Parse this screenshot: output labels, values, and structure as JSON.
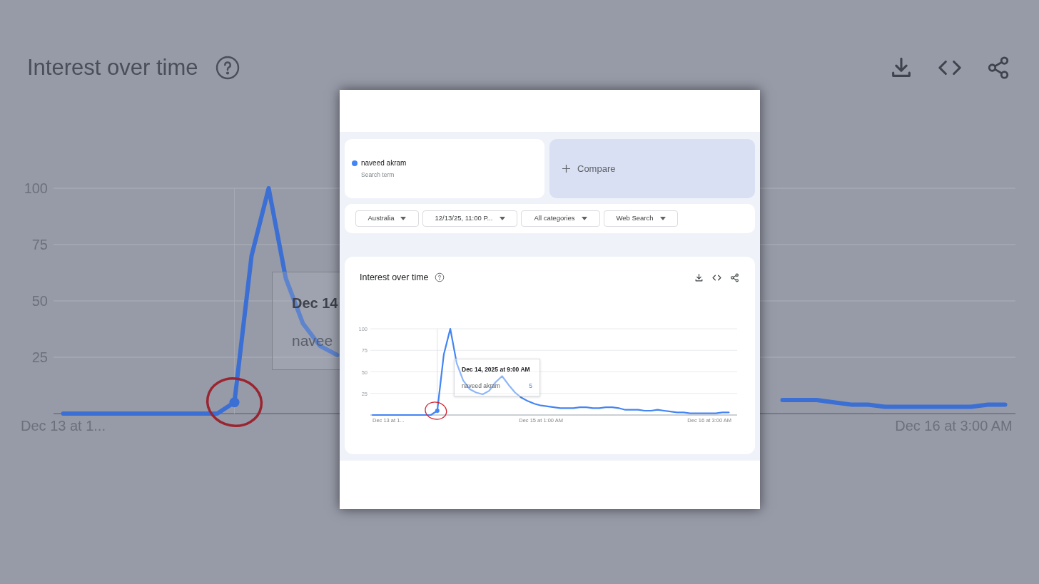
{
  "background": {
    "title": "Interest over time",
    "chart_data": {
      "type": "line",
      "ylim": [
        0,
        100
      ],
      "yticks": [
        25,
        50,
        75,
        100
      ],
      "grid": true,
      "series": [
        {
          "color": "#3b6fd4",
          "values": [
            0,
            0,
            0,
            0,
            0,
            0,
            0,
            0,
            0,
            0,
            5,
            70,
            100,
            60,
            40,
            30,
            26,
            null,
            null,
            null,
            null,
            null,
            null,
            null,
            null,
            null,
            null,
            null,
            null,
            null,
            null,
            null,
            null,
            null,
            null,
            null,
            null,
            null,
            null,
            null,
            null,
            null,
            6,
            6,
            6,
            5,
            4,
            4,
            3,
            3,
            3,
            3,
            3,
            3,
            4,
            4
          ]
        }
      ]
    },
    "x_labels": [
      "Dec 13 at 1...",
      "Dec 16 at 3:00 AM"
    ],
    "tooltip": {
      "title": "Dec 14",
      "term": "navee"
    }
  },
  "frame": {
    "search_term": {
      "name": "naveed akram",
      "subtitle": "Search term",
      "color": "#4285f4"
    },
    "compare": "Compare",
    "filters": [
      "Australia",
      "12/13/25, 11:00 P...",
      "All categories",
      "Web Search"
    ],
    "card": {
      "title": "Interest over time",
      "chart_data": {
        "type": "line",
        "ylim": [
          0,
          100
        ],
        "yticks": [
          25,
          50,
          75,
          100
        ],
        "grid": true,
        "series": [
          {
            "color": "#4285f4",
            "values": [
              0,
              0,
              0,
              0,
              0,
              0,
              0,
              0,
              0,
              0,
              5,
              70,
              100,
              60,
              40,
              30,
              26,
              24,
              28,
              38,
              45,
              35,
              26,
              20,
              16,
              13,
              11,
              10,
              9,
              8,
              8,
              8,
              9,
              9,
              8,
              8,
              9,
              9,
              8,
              6,
              6,
              6,
              5,
              5,
              6,
              5,
              4,
              3,
              3,
              2,
              2,
              2,
              2,
              2,
              3,
              3
            ]
          }
        ]
      },
      "x_labels": [
        "Dec 13 at 1...",
        "Dec 15 at 1:00 AM",
        "Dec 16 at 3:00 AM"
      ],
      "tooltip": {
        "title": "Dec 14, 2025 at 9:00 AM",
        "term": "naveed akram",
        "value": "5"
      }
    }
  }
}
